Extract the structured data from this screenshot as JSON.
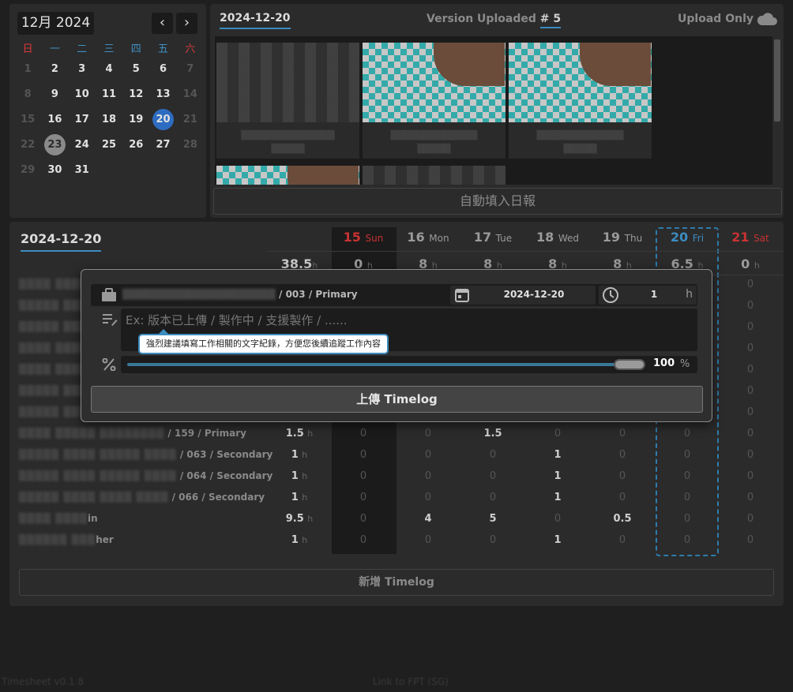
{
  "calendar": {
    "title": "12月 2024",
    "prev": "‹",
    "next": "›",
    "weekdays": [
      "日",
      "一",
      "二",
      "三",
      "四",
      "五",
      "六"
    ],
    "weeks": [
      [
        "1",
        "2",
        "3",
        "4",
        "5",
        "6",
        "7"
      ],
      [
        "8",
        "9",
        "10",
        "11",
        "12",
        "13",
        "14"
      ],
      [
        "15",
        "16",
        "17",
        "18",
        "19",
        "20",
        "21"
      ],
      [
        "22",
        "23",
        "24",
        "25",
        "26",
        "27",
        "28"
      ],
      [
        "29",
        "30",
        "31",
        "",
        "",
        "",
        ""
      ]
    ],
    "selected": "20",
    "today": "23"
  },
  "uploads": {
    "date": "2024-12-20",
    "version_label": "Version Uploaded",
    "version_num": "# 5",
    "upload_only": "Upload Only",
    "auto_fill": "自動填入日報"
  },
  "sheet": {
    "date": "2024-12-20",
    "days": [
      {
        "num": "15",
        "name": "Sun",
        "total": "0",
        "style": "red"
      },
      {
        "num": "16",
        "name": "Mon",
        "total": "8",
        "style": ""
      },
      {
        "num": "17",
        "name": "Tue",
        "total": "8",
        "style": ""
      },
      {
        "num": "18",
        "name": "Wed",
        "total": "8",
        "style": ""
      },
      {
        "num": "19",
        "name": "Thu",
        "total": "8",
        "style": ""
      },
      {
        "num": "20",
        "name": "Fri",
        "total": "6.5",
        "style": "blue"
      },
      {
        "num": "21",
        "name": "Sat",
        "total": "0",
        "style": "red"
      }
    ],
    "week_total": "38.5",
    "hour_unit": "h",
    "rows": [
      {
        "name": "",
        "code": "",
        "type": "",
        "sum": "",
        "vals": [
          "",
          "",
          "",
          "",
          "",
          "",
          "0"
        ]
      },
      {
        "name": "",
        "code": "",
        "type": "",
        "sum": "",
        "vals": [
          "",
          "",
          "",
          "",
          "",
          "",
          "0"
        ]
      },
      {
        "name": "",
        "code": "",
        "type": "",
        "sum": "",
        "vals": [
          "",
          "",
          "",
          "",
          "",
          "",
          "0"
        ]
      },
      {
        "name": "",
        "code": "",
        "type": "",
        "sum": "",
        "vals": [
          "",
          "",
          "",
          "",
          "",
          "",
          "0"
        ]
      },
      {
        "name": "",
        "code": "",
        "type": "",
        "sum": "",
        "vals": [
          "",
          "",
          "",
          "",
          "",
          "",
          "0"
        ]
      },
      {
        "name": "",
        "code": "",
        "type": "",
        "sum": "",
        "vals": [
          "",
          "",
          "",
          "",
          "",
          "",
          "0"
        ]
      },
      {
        "name": "",
        "code": "",
        "type": "",
        "sum": "",
        "vals": [
          "",
          "",
          "",
          "",
          "",
          "",
          "0"
        ]
      },
      {
        "name": "",
        "code": "159",
        "type": "Primary",
        "sum": "1.5",
        "vals": [
          "0",
          "0",
          "1.5",
          "0",
          "0",
          "0",
          "0"
        ]
      },
      {
        "name": "",
        "code": "063",
        "type": "Secondary",
        "sum": "1",
        "vals": [
          "0",
          "0",
          "0",
          "1",
          "0",
          "0",
          "0"
        ]
      },
      {
        "name": "",
        "code": "064",
        "type": "Secondary",
        "sum": "1",
        "vals": [
          "0",
          "0",
          "0",
          "1",
          "0",
          "0",
          "0"
        ]
      },
      {
        "name": "",
        "code": "066",
        "type": "Secondary",
        "sum": "1",
        "vals": [
          "0",
          "0",
          "0",
          "1",
          "0",
          "0",
          "0"
        ]
      },
      {
        "name": "in",
        "code": "",
        "type": "",
        "sum": "9.5",
        "vals": [
          "0",
          "4",
          "5",
          "0",
          "0.5",
          "0",
          "0"
        ]
      },
      {
        "name": "her",
        "code": "",
        "type": "",
        "sum": "1",
        "vals": [
          "0",
          "0",
          "0",
          "1",
          "0",
          "0",
          "0"
        ]
      }
    ],
    "add_button": "新增 Timelog"
  },
  "modal": {
    "project_code": "003",
    "project_type": "Primary",
    "sep": "/",
    "date": "2024-12-20",
    "hours": "1",
    "hour_unit": "h",
    "placeholder": "Ex: 版本已上傳 / 製作中 / 支援製作 / ......",
    "tooltip": "強烈建議填寫工作相關的文字紀錄，方便您後續追蹤工作內容",
    "percent": "100",
    "percent_unit": "%",
    "progress": 1.0,
    "upload_button": "上傳 Timelog"
  },
  "footer": {
    "version": "Timesheet v0.1.8",
    "link": "Link to FPT (SG)"
  }
}
